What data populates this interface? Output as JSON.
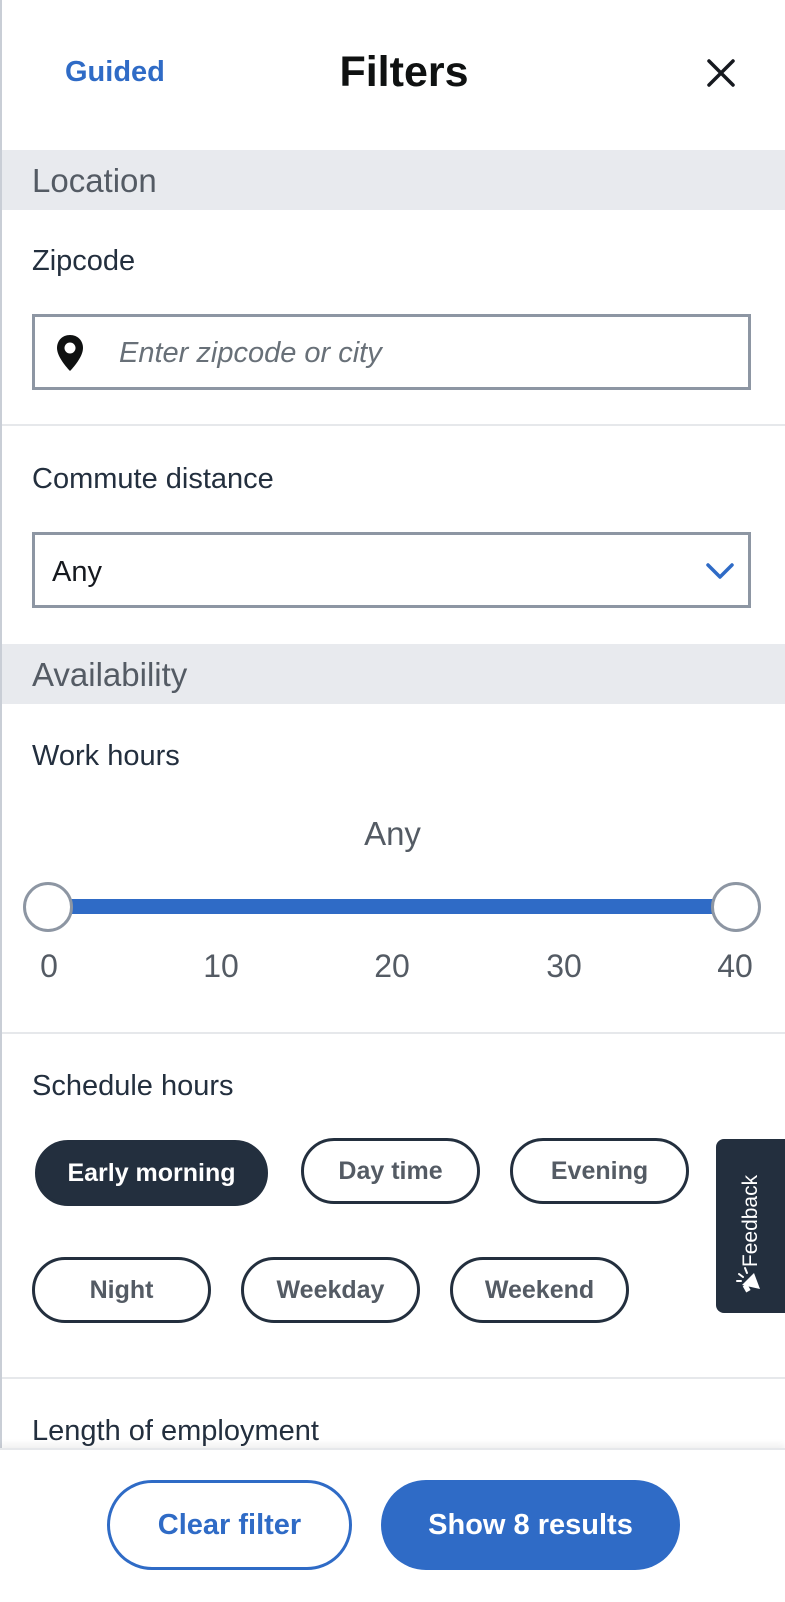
{
  "header": {
    "guided_label": "Guided",
    "title": "Filters",
    "close_icon": "close-icon"
  },
  "location": {
    "section_title": "Location",
    "zipcode_label": "Zipcode",
    "zipcode_placeholder": "Enter zipcode or city",
    "zipcode_value": "",
    "commute_label": "Commute distance",
    "commute_value": "Any"
  },
  "availability": {
    "section_title": "Availability",
    "work_hours_label": "Work hours",
    "work_hours_value": "Any",
    "work_hours_range": {
      "min": 0,
      "max": 40,
      "selected_min": 0,
      "selected_max": 40
    },
    "work_hours_ticks": [
      "0",
      "10",
      "20",
      "30",
      "40"
    ],
    "schedule_label": "Schedule hours",
    "schedule_options": [
      {
        "label": "Early morning",
        "selected": true
      },
      {
        "label": "Day time",
        "selected": false
      },
      {
        "label": "Evening",
        "selected": false
      },
      {
        "label": "Night",
        "selected": false
      },
      {
        "label": "Weekday",
        "selected": false
      },
      {
        "label": "Weekend",
        "selected": false
      }
    ],
    "length_label": "Length of employment"
  },
  "feedback": {
    "label": "Feedback",
    "icon": "megaphone-icon"
  },
  "footer": {
    "clear_label": "Clear filter",
    "show_label": "Show 8 results"
  },
  "colors": {
    "accent": "#2f6bc6",
    "dark": "#232f3e",
    "section_band": "#e8eaee"
  }
}
